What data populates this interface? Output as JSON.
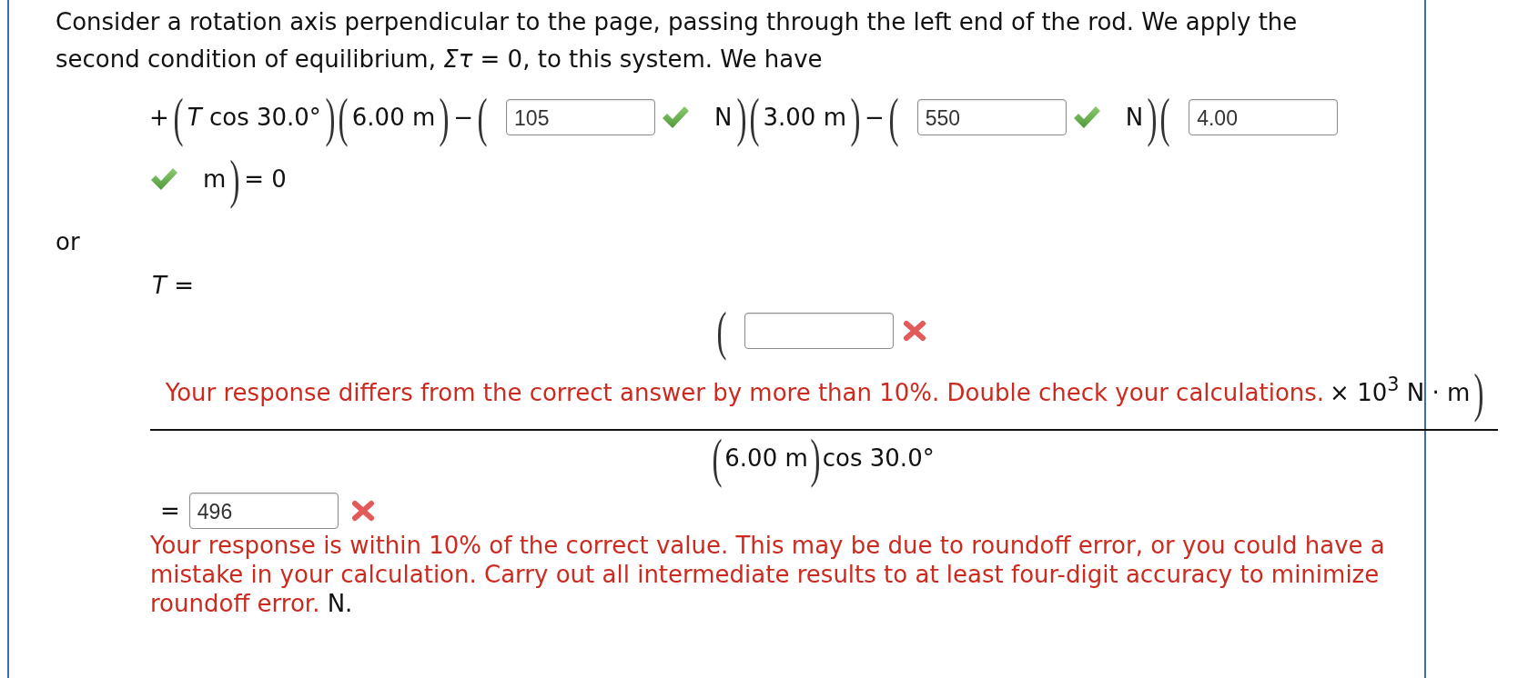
{
  "intro": "Consider a rotation axis perpendicular to the page, passing through the left end of the rod. We apply the second condition of equilibrium, *Στ* = 0, to this system. We have",
  "equation": {
    "terms": [
      {
        "kind": "text",
        "text": "+"
      },
      {
        "kind": "open",
        "text": "("
      },
      {
        "kind": "text",
        "text": "*T* cos 30.0°"
      },
      {
        "kind": "close",
        "text": ")"
      },
      {
        "kind": "open",
        "text": "("
      },
      {
        "kind": "text",
        "text": "6.00 m"
      },
      {
        "kind": "close",
        "text": ")"
      },
      {
        "kind": "text",
        "text": "−"
      },
      {
        "kind": "open",
        "text": "("
      },
      {
        "kind": "input",
        "value": "105"
      },
      {
        "kind": "mark",
        "correct": true
      },
      {
        "kind": "text",
        "text": "N"
      },
      {
        "kind": "close",
        "text": ")"
      },
      {
        "kind": "open",
        "text": "("
      },
      {
        "kind": "text",
        "text": "3.00 m"
      },
      {
        "kind": "close",
        "text": ")"
      },
      {
        "kind": "text",
        "text": "−"
      },
      {
        "kind": "open",
        "text": "("
      },
      {
        "kind": "input",
        "value": "550"
      },
      {
        "kind": "mark",
        "correct": true
      },
      {
        "kind": "text",
        "text": "N"
      },
      {
        "kind": "close",
        "text": ")"
      },
      {
        "kind": "open",
        "text": "("
      },
      {
        "kind": "input",
        "value": "4.00"
      },
      {
        "kind": "mark",
        "correct": true
      },
      {
        "kind": "text",
        "text": "m"
      },
      {
        "kind": "close",
        "text": ")"
      },
      {
        "kind": "text",
        "text": "= 0"
      }
    ]
  },
  "connector": "or",
  "solution": {
    "label": "*T* =",
    "numerator": {
      "open": "(",
      "answer": {
        "correct": false
      },
      "feedback": "Your response differs from the correct answer by more than 10%. Double check your calculations.",
      "unit": "× 10$^{3}$ N · m",
      "close": ")"
    },
    "denominator": [
      {
        "kind": "open",
        "text": "("
      },
      {
        "kind": "text",
        "text": "6.00 m"
      },
      {
        "kind": "close",
        "text": ")"
      },
      {
        "kind": "text",
        "text": "cos 30.0°"
      }
    ],
    "result": [
      {
        "kind": "text",
        "text": "="
      },
      {
        "kind": "input",
        "value": "496"
      },
      {
        "kind": "mark",
        "correct": false
      }
    ],
    "feedback": "Your response is within 10% of the correct value. This may be due to roundoff error, or you could have a mistake in your calculation. Carry out all intermediate results to at least four-digit accuracy to minimize roundoff error.",
    "unit": "N."
  }
}
